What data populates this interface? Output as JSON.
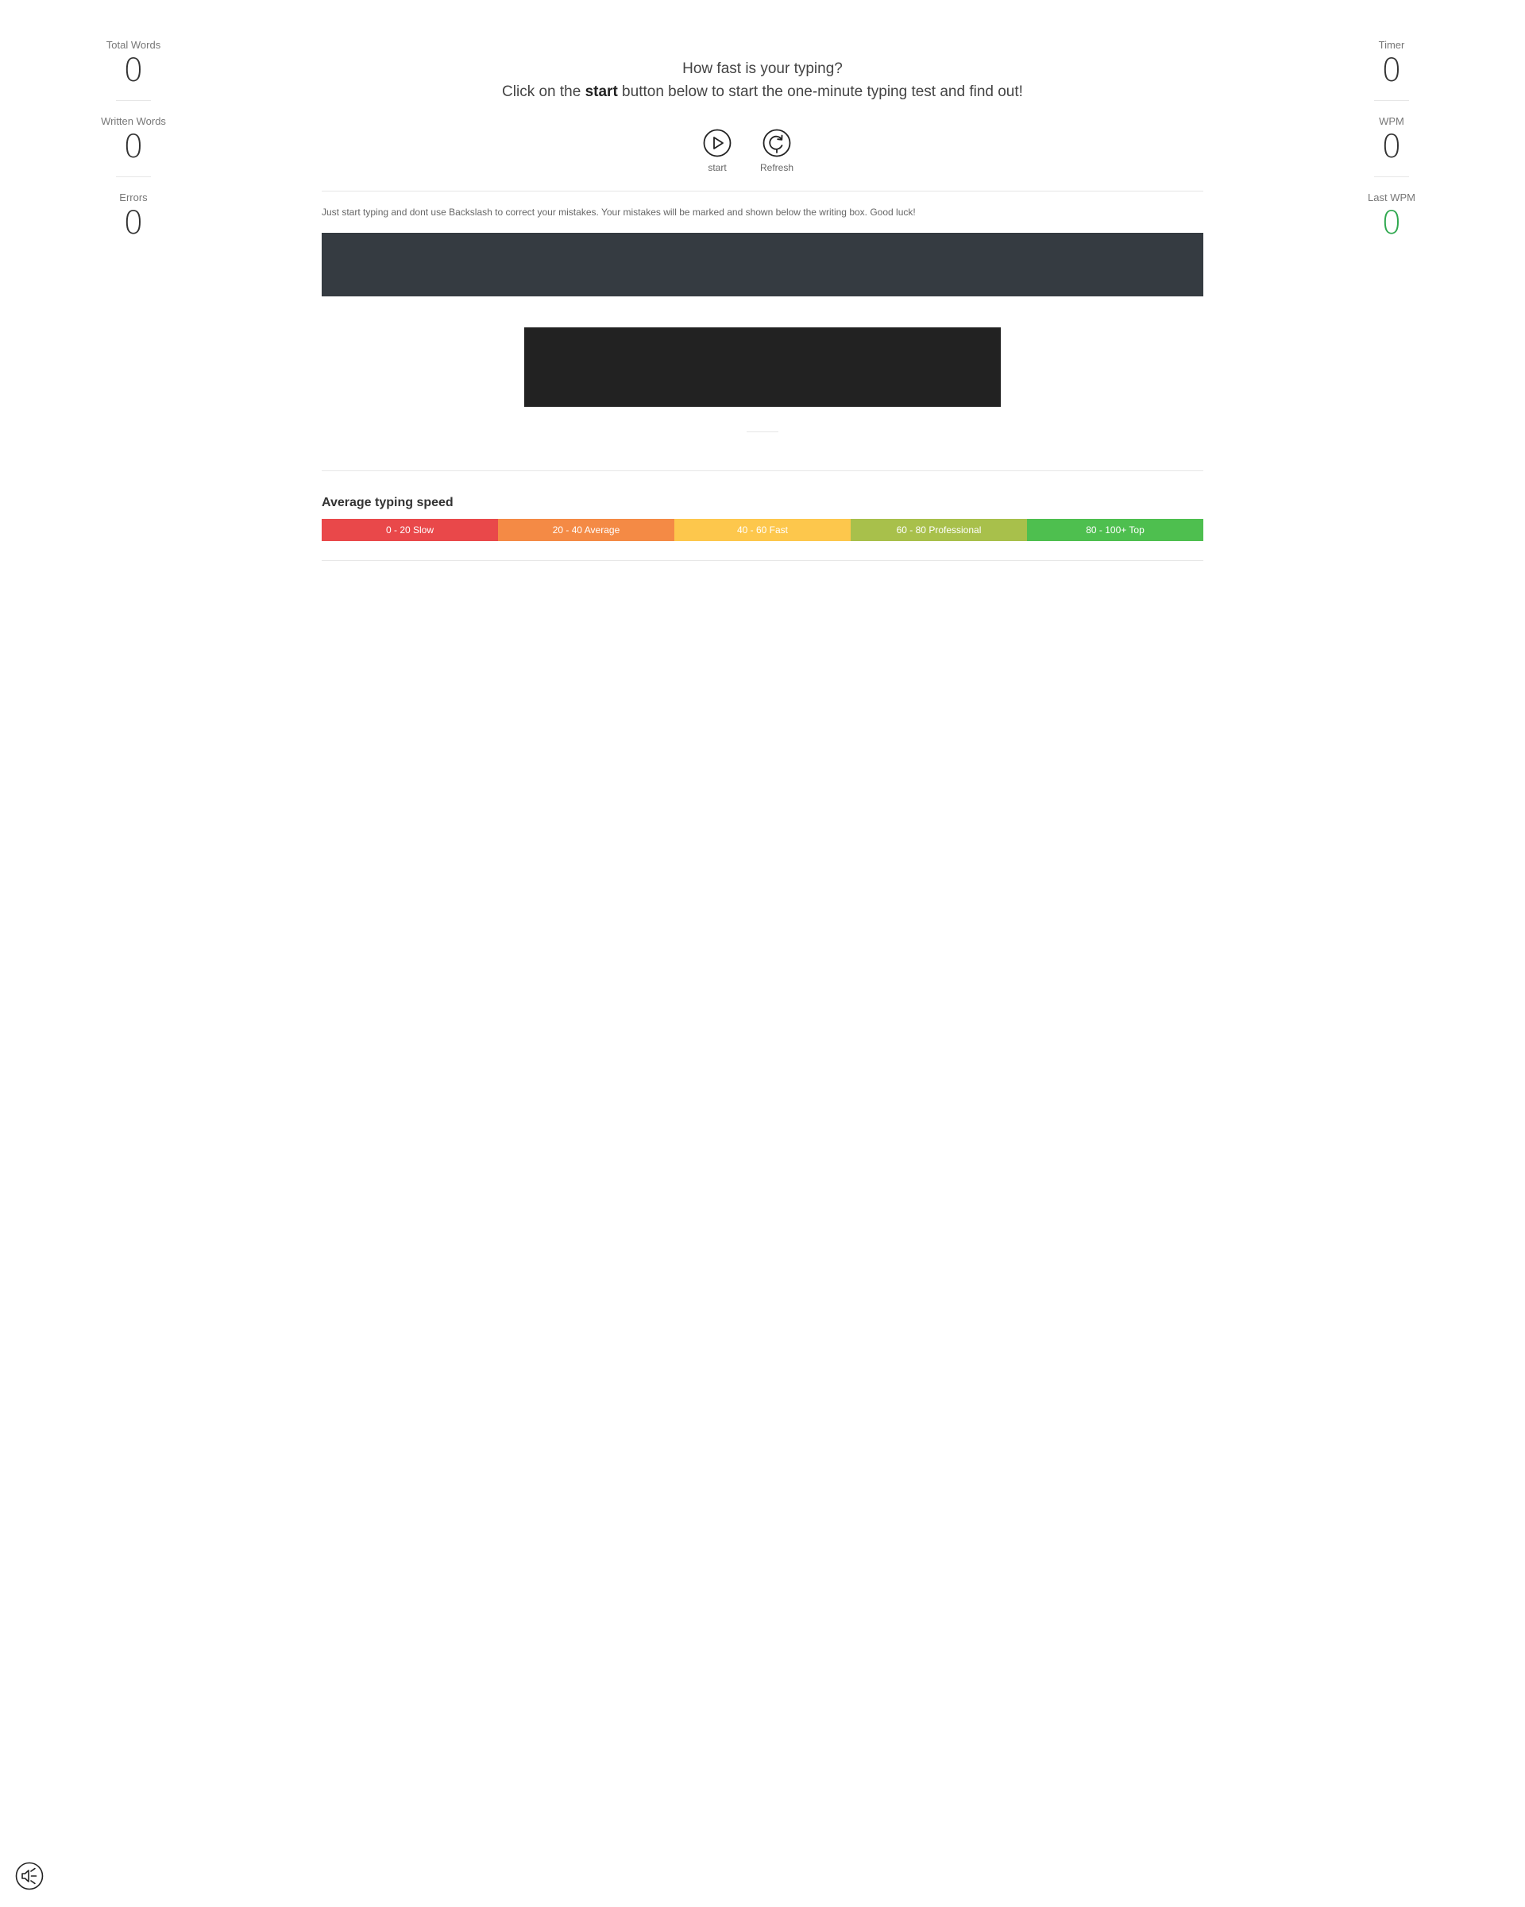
{
  "stats_left": [
    {
      "label": "Total Words",
      "value": "0"
    },
    {
      "label": "Written Words",
      "value": "0"
    },
    {
      "label": "Errors",
      "value": "0"
    }
  ],
  "stats_right": [
    {
      "label": "Timer",
      "value": "0"
    },
    {
      "label": "WPM",
      "value": "0"
    },
    {
      "label": "Last WPM",
      "value": "0"
    }
  ],
  "intro": {
    "line1": "How fast is your typing?",
    "line2_before": "Click on the ",
    "line2_bold": "start",
    "line2_after": " button below to start the one-minute typing test and find out!"
  },
  "controls": {
    "start_label": "start",
    "refresh_label": "Refresh"
  },
  "hint": "Just start typing and dont use Backslash to correct your mistakes. Your mistakes will be marked and shown below the writing box. Good luck!",
  "typing_input": {
    "value": ""
  },
  "average": {
    "title": "Average typing speed",
    "segments": [
      {
        "label": "0 - 20 Slow",
        "color": "#e9484a"
      },
      {
        "label": "20 - 40 Average",
        "color": "#f48a45"
      },
      {
        "label": "40 - 60 Fast",
        "color": "#fdc74c"
      },
      {
        "label": "60 - 80 Professional",
        "color": "#a8c04b"
      },
      {
        "label": "80 - 100+ Top",
        "color": "#4ebf4f"
      }
    ]
  },
  "colors": {
    "text_display_bg": "#353b41",
    "input_bg": "#222222",
    "last_wpm_green": "#2fa84f"
  },
  "icons": {
    "start": "play-circle-icon",
    "refresh": "refresh-circle-icon",
    "sound": "sound-off-icon"
  }
}
